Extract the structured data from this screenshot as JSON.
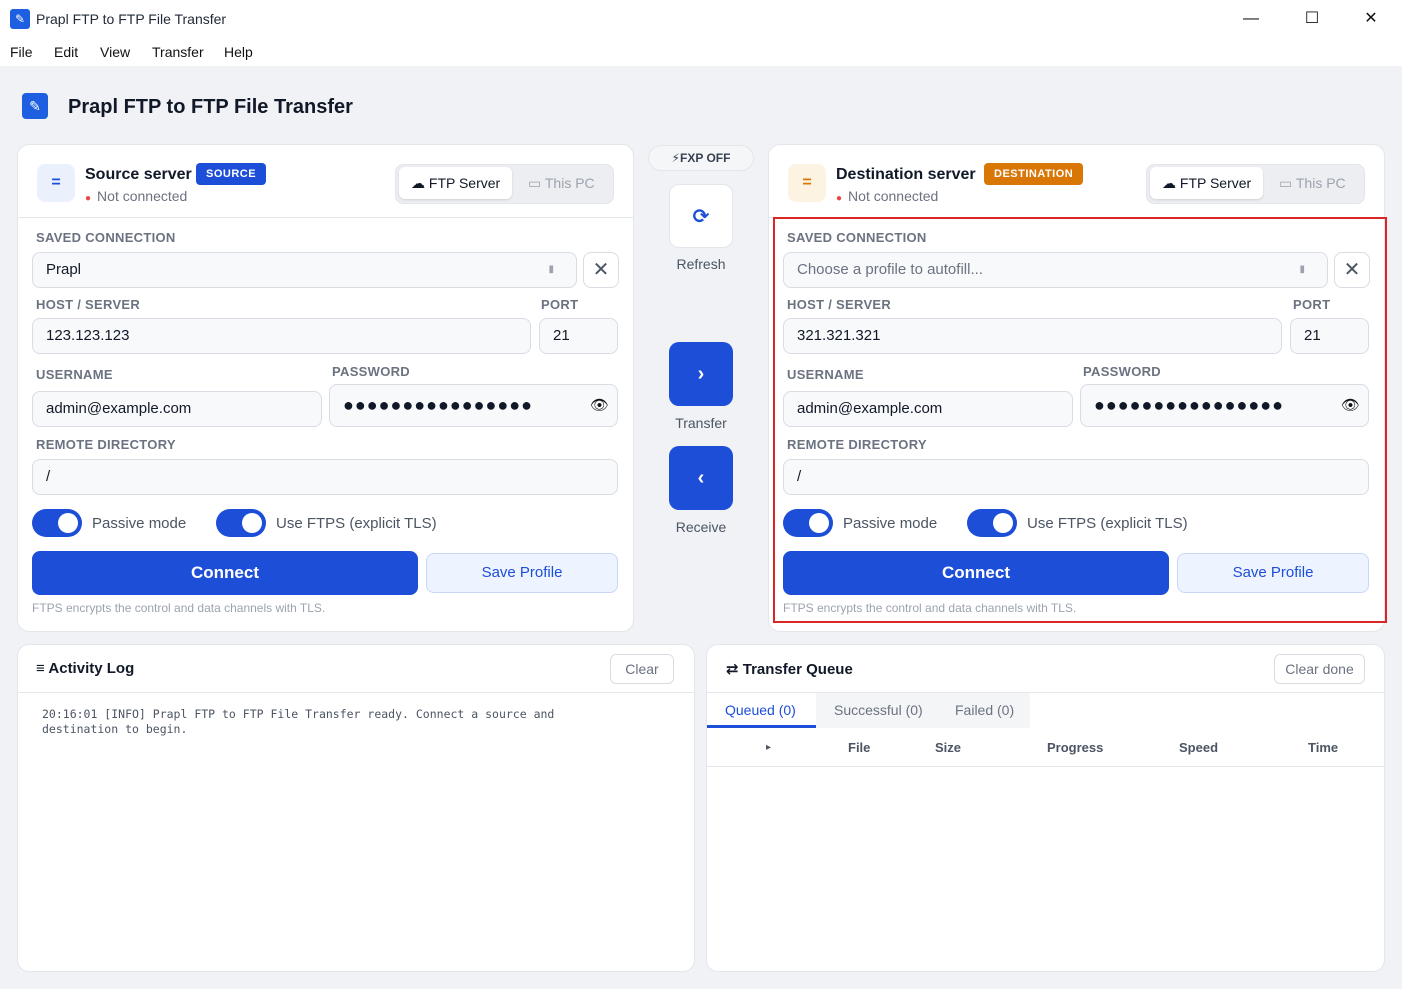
{
  "window": {
    "title": "Prapl FTP to FTP File Transfer",
    "minimize": "—",
    "maximize": "☐",
    "close": "✕"
  },
  "menu": [
    "File",
    "Edit",
    "View",
    "Transfer",
    "Help"
  ],
  "header": {
    "title": "Prapl FTP to FTP File Transfer"
  },
  "source": {
    "title": "Source server",
    "badge": "SOURCE",
    "status": "Not connected",
    "tabs": [
      "FTP Server",
      "This PC"
    ],
    "saved_connection_label": "SAVED CONNECTION",
    "saved_connection_value": "Prapl",
    "host_label": "HOST / SERVER",
    "host_value": "123.123.123",
    "port_label": "PORT",
    "port_value": "21",
    "username_label": "USERNAME",
    "username_value": "admin@example.com",
    "password_label": "PASSWORD",
    "password_dots": "●●●●●●●●●●●●●●●●",
    "remote_dir_label": "REMOTE DIRECTORY",
    "remote_dir_value": "/",
    "passive_label": "Passive mode",
    "ftps_label": "Use FTPS (explicit TLS)",
    "connect_label": "Connect",
    "save_profile_label": "Save Profile",
    "hint": "FTPS encrypts the control and data channels with TLS."
  },
  "destination": {
    "title": "Destination server",
    "badge": "DESTINATION",
    "status": "Not connected",
    "tabs": [
      "FTP Server",
      "This PC"
    ],
    "saved_connection_label": "SAVED CONNECTION",
    "saved_connection_placeholder": "Choose a profile to autofill...",
    "host_label": "HOST / SERVER",
    "host_value": "321.321.321",
    "port_label": "PORT",
    "port_value": "21",
    "username_label": "USERNAME",
    "username_value": "admin@example.com",
    "password_label": "PASSWORD",
    "password_dots": "●●●●●●●●●●●●●●●●",
    "remote_dir_label": "REMOTE DIRECTORY",
    "remote_dir_value": "/",
    "passive_label": "Passive mode",
    "ftps_label": "Use FTPS (explicit TLS)",
    "connect_label": "Connect",
    "save_profile_label": "Save Profile",
    "hint": "FTPS encrypts the control and data channels with TLS."
  },
  "middle": {
    "fxp_label": "FXP OFF",
    "refresh_label": "Refresh",
    "transfer_label": "Transfer",
    "receive_label": "Receive"
  },
  "activity_log": {
    "title": "Activity Log",
    "clear_label": "Clear",
    "lines": [
      "20:16:01 [INFO] Prapl FTP to FTP File Transfer ready. Connect a source and",
      "destination to begin."
    ]
  },
  "queue": {
    "title": "Transfer Queue",
    "clear_done_label": "Clear done",
    "tabs": [
      "Queued (0)",
      "Successful (0)",
      "Failed (0)"
    ],
    "columns": [
      "▸",
      "File",
      "Size",
      "Progress",
      "Speed",
      "Time"
    ]
  },
  "colors": {
    "primary": "#1d4ed8",
    "source_badge": "#1d4ed8",
    "destination_badge": "#d97706",
    "highlight": "#dc2626"
  }
}
